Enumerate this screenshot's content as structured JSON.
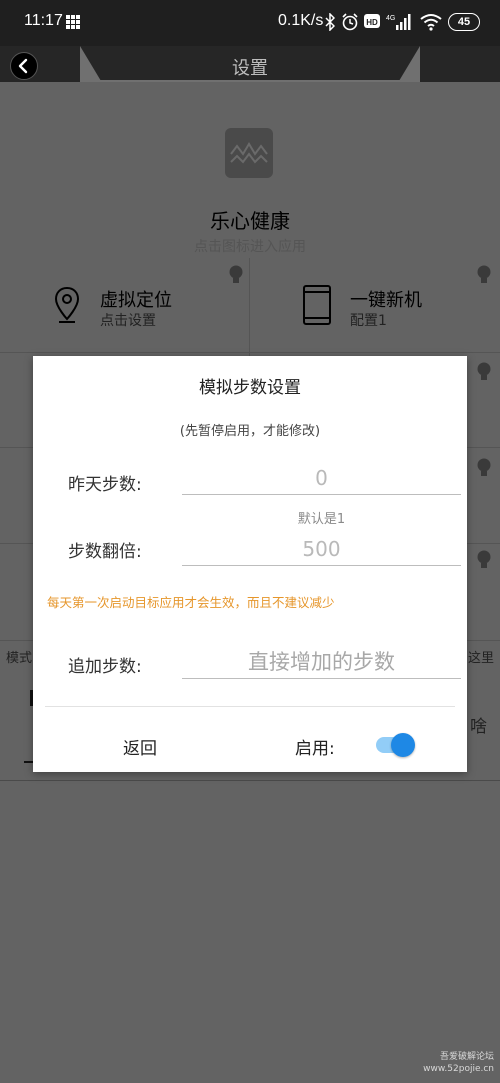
{
  "status_bar": {
    "time": "11:17",
    "network_speed": "0.1K/s",
    "battery": "45"
  },
  "header": {
    "title": "设置"
  },
  "app": {
    "name": "乐心健康",
    "hint": "点击图标进入应用"
  },
  "cells": [
    {
      "title": "虚拟定位",
      "subtitle": "点击设置",
      "icon": "location-pin-icon"
    },
    {
      "title": "一键新机",
      "subtitle": "配置1",
      "icon": "phone-icon"
    }
  ],
  "background_fragments": {
    "left": "模式",
    "right": "这里",
    "right2": "啥"
  },
  "dialog": {
    "title": "模拟步数设置",
    "note": "(先暂停启用，才能修改)",
    "yesterday_label": "昨天步数:",
    "yesterday_value": "0",
    "default_hint": "默认是1",
    "multiplier_label": "步数翻倍:",
    "multiplier_value": "500",
    "warning": "每天第一次启动目标应用才会生效，而且不建议减少",
    "add_label": "追加步数:",
    "add_placeholder": "直接增加的步数",
    "back_label": "返回",
    "enable_label": "启用:",
    "enabled": true
  },
  "watermark": {
    "line1": "吾爱破解论坛",
    "line2": "www.52pojie.cn"
  },
  "colors": {
    "switch_on": "#1e88e5",
    "warning": "#e6962b"
  }
}
